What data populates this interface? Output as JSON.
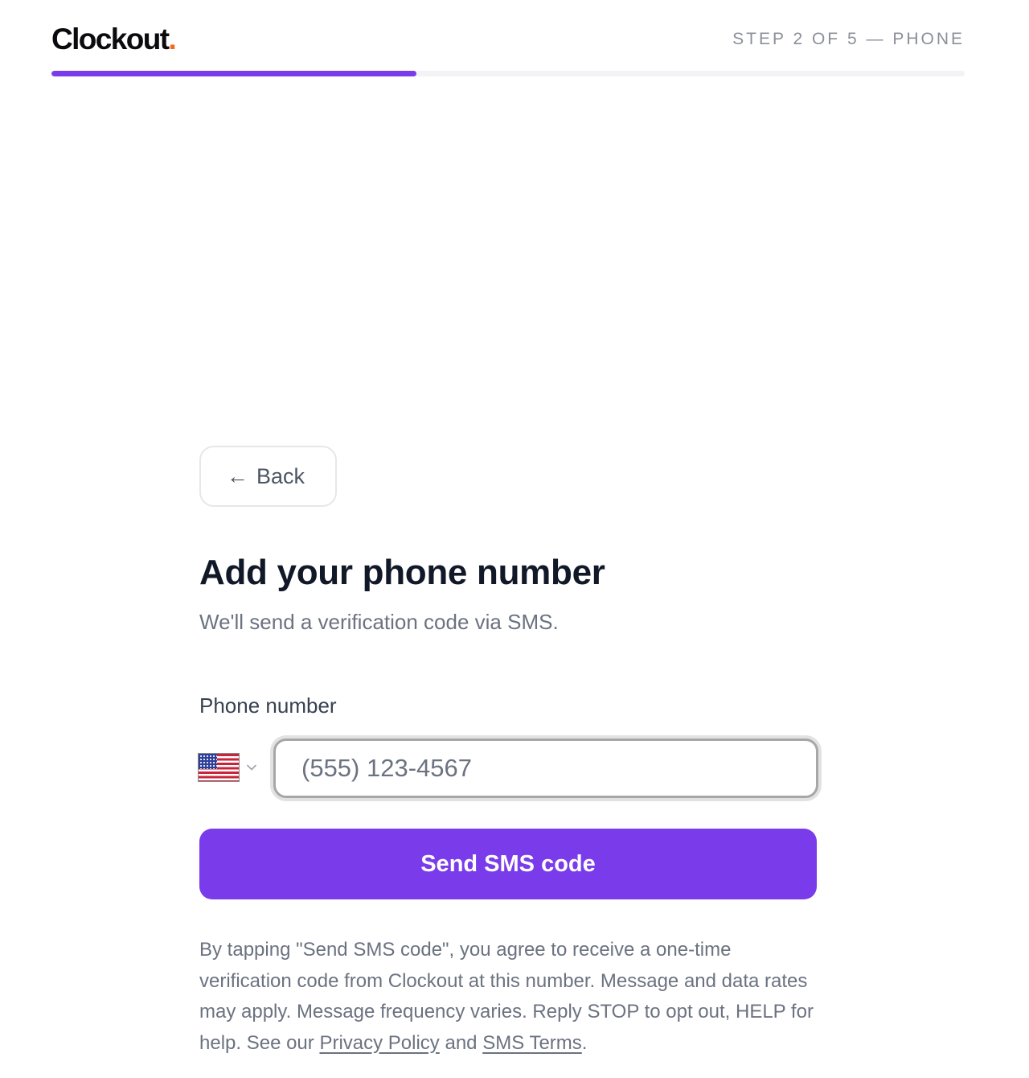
{
  "header": {
    "logo_text": "Clockout",
    "logo_dot": ".",
    "step_label": "STEP 2 OF 5 — PHONE"
  },
  "progress": {
    "fraction": 0.4
  },
  "content": {
    "back_arrow": "←",
    "back_label": "Back",
    "title": "Add your phone number",
    "subtitle": "We'll send a verification code via SMS.",
    "phone_label": "Phone number",
    "country": "flag-us-icon",
    "phone_placeholder": "(555) 123-4567",
    "phone_value": "",
    "send_button_label": "Send SMS code"
  },
  "disclaimer": {
    "text_before": "By tapping \"Send SMS code\", you agree to receive a one-time verification code from Clockout at this number. Message and data rates may apply. Message frequency varies. Reply STOP to opt out, HELP for help. See our ",
    "privacy_link": "Privacy Policy",
    "text_middle": " and ",
    "terms_link": "SMS Terms",
    "text_after": "."
  },
  "colors": {
    "accent": "#7a3cea",
    "logo_dot": "#f26b1d",
    "muted_text": "#6b7280"
  }
}
